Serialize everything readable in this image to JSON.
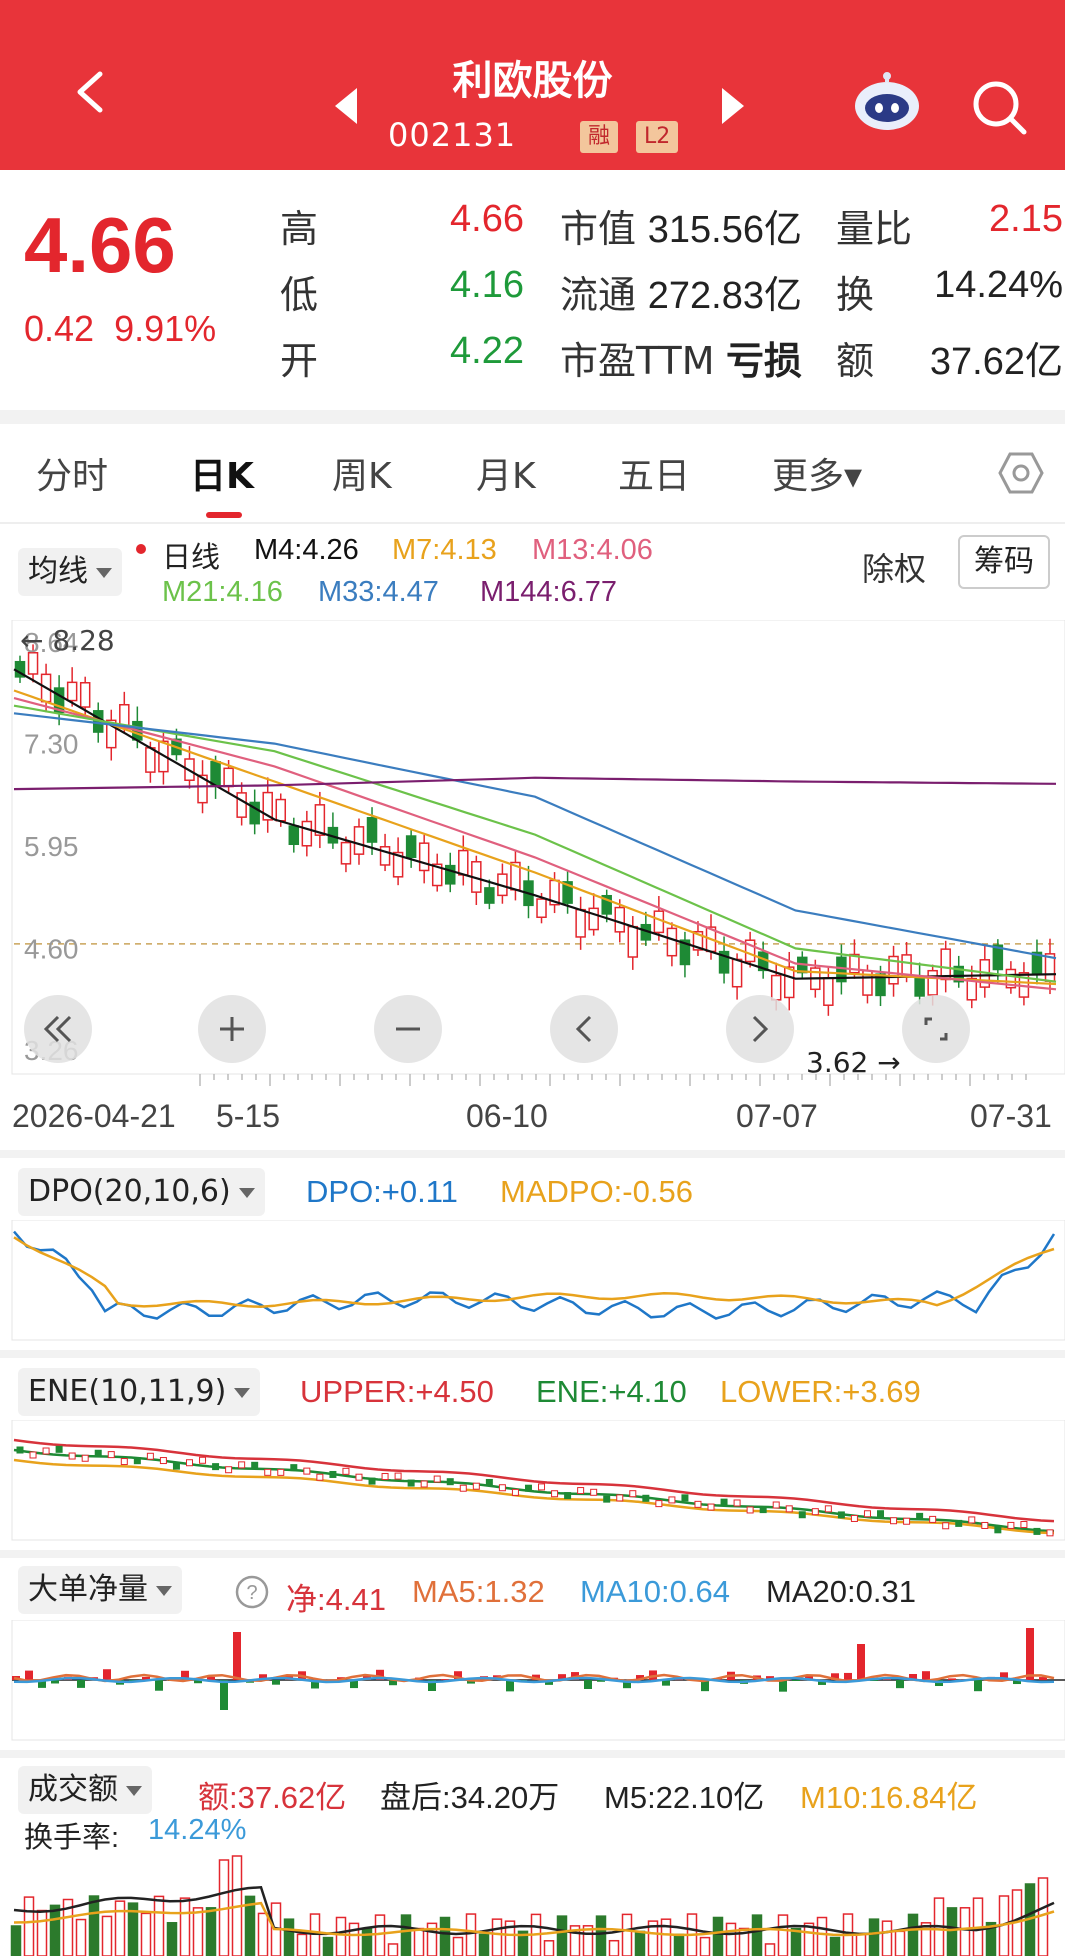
{
  "header": {
    "title": "利欧股份",
    "code": "002131",
    "badges": [
      "融",
      "L2"
    ]
  },
  "quote": {
    "price": "4.66",
    "change": "0.42",
    "change_pct": "9.91%",
    "stats": [
      {
        "label": "高",
        "value": "4.66",
        "color": "red"
      },
      {
        "label": "低",
        "value": "4.16",
        "color": "green"
      },
      {
        "label": "开",
        "value": "4.22",
        "color": "green"
      },
      {
        "label": "市值",
        "value": "315.56亿",
        "color": "dark"
      },
      {
        "label": "流通",
        "value": "272.83亿",
        "color": "dark"
      },
      {
        "label": "市盈TTM",
        "value": "亏损",
        "color": "dark"
      },
      {
        "label": "量比",
        "value": "2.15",
        "color": "red"
      },
      {
        "label": "换",
        "value": "14.24%",
        "color": "dark"
      },
      {
        "label": "额",
        "value": "37.62亿",
        "color": "dark"
      }
    ]
  },
  "tabs": [
    "分时",
    "日K",
    "周K",
    "月K",
    "五日",
    "更多▾"
  ],
  "active_tab": "日K",
  "kline": {
    "selector": "均线",
    "legend": [
      {
        "name": "日线",
        "color": "#222222"
      },
      {
        "name": "M4:4.26",
        "color": "#111111"
      },
      {
        "name": "M7:4.13",
        "color": "#e8a21c"
      },
      {
        "name": "M13:4.06",
        "color": "#e0607e"
      },
      {
        "name": "M21:4.16",
        "color": "#6cc24a"
      },
      {
        "name": "M33:4.47",
        "color": "#3b7dbf"
      },
      {
        "name": "M144:6.77",
        "color": "#7a1e6e"
      }
    ],
    "btn_fuquan": "除权",
    "btn_chouma": "筹码",
    "y_ticks": [
      "8.64",
      "7.30",
      "5.95",
      "4.60",
      "3.26"
    ],
    "max_label": "8.28",
    "min_label": "3.62",
    "dates": [
      "2026-04-21",
      "5-15",
      "06-10",
      "07-07",
      "07-31"
    ]
  },
  "chart_data": {
    "type": "line",
    "x": [
      "2026-04-21",
      "05-15",
      "06-10",
      "07-07",
      "07-31"
    ],
    "series": [
      {
        "name": "M4",
        "values": [
          8.28,
          6.3,
          5.3,
          4.2,
          4.26
        ]
      },
      {
        "name": "M7",
        "values": [
          8.0,
          6.8,
          5.6,
          4.3,
          4.13
        ]
      },
      {
        "name": "M13",
        "values": [
          7.9,
          7.0,
          5.8,
          4.4,
          4.06
        ]
      },
      {
        "name": "M21",
        "values": [
          7.8,
          7.2,
          6.1,
          4.6,
          4.16
        ]
      },
      {
        "name": "M33",
        "values": [
          7.7,
          7.3,
          6.6,
          5.1,
          4.47
        ]
      },
      {
        "name": "M144",
        "values": [
          6.7,
          6.75,
          6.85,
          6.8,
          6.77
        ]
      }
    ],
    "ylim": [
      3.26,
      8.64
    ]
  },
  "dpo": {
    "selector": "DPO(20,10,6)",
    "vals": [
      {
        "text": "DPO:+0.11",
        "color": "#1f77c8"
      },
      {
        "text": "MADPO:-0.56",
        "color": "#e8a21c"
      }
    ]
  },
  "ene": {
    "selector": "ENE(10,11,9)",
    "vals": [
      {
        "text": "UPPER:+4.50",
        "color": "#d7333b"
      },
      {
        "text": "ENE:+4.10",
        "color": "#1e8a35"
      },
      {
        "text": "LOWER:+3.69",
        "color": "#e8a21c"
      }
    ]
  },
  "bigorder": {
    "selector": "大单净量",
    "vals": [
      {
        "text": "净:4.41",
        "color": "#d7333b"
      },
      {
        "text": "MA5:1.32",
        "color": "#e0703a"
      },
      {
        "text": "MA10:0.64",
        "color": "#3b9ad9"
      },
      {
        "text": "MA20:0.31",
        "color": "#222222"
      }
    ]
  },
  "volume": {
    "selector": "成交额",
    "vals": [
      {
        "text": "额:37.62亿",
        "color": "#d7333b"
      },
      {
        "text": "盘后:34.20万",
        "color": "#222222"
      },
      {
        "text": "M5:22.10亿",
        "color": "#222222"
      },
      {
        "text": "M10:16.84亿",
        "color": "#e8a21c"
      }
    ],
    "turnover_label": "换手率:",
    "turnover_value": "14.24%"
  }
}
